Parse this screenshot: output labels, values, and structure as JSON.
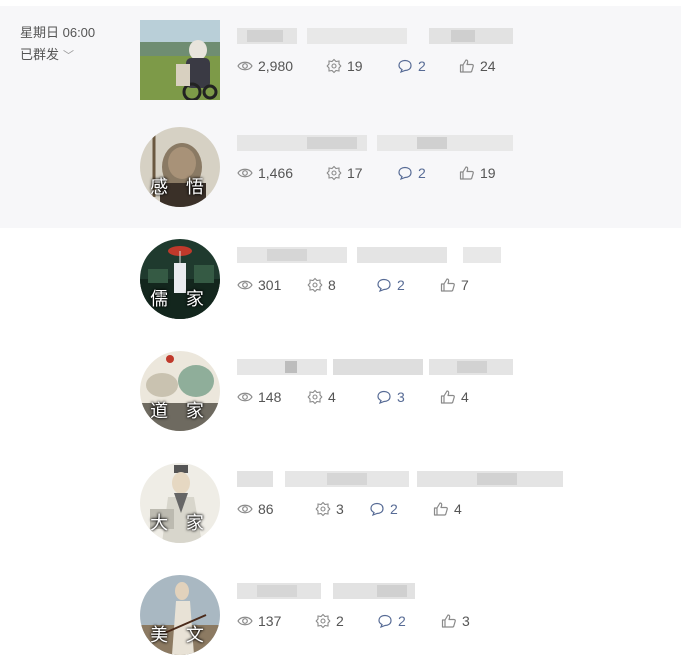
{
  "header": {
    "weekday_time": "星期日 06:00",
    "status": "已群发"
  },
  "colors": {
    "accent": "#576b95",
    "band": "#f7f7f9"
  },
  "articles": [
    {
      "caption": "",
      "views": "2,980",
      "shares": "19",
      "comments": "2",
      "likes": "24"
    },
    {
      "caption": "感 悟",
      "views": "1,466",
      "shares": "17",
      "comments": "2",
      "likes": "19"
    },
    {
      "caption": "儒 家",
      "views": "301",
      "shares": "8",
      "comments": "2",
      "likes": "7"
    },
    {
      "caption": "道 家",
      "views": "148",
      "shares": "4",
      "comments": "3",
      "likes": "4"
    },
    {
      "caption": "大 家",
      "views": "86",
      "shares": "3",
      "comments": "2",
      "likes": "4"
    },
    {
      "caption": "美 文",
      "views": "137",
      "shares": "2",
      "comments": "2",
      "likes": "3"
    }
  ]
}
